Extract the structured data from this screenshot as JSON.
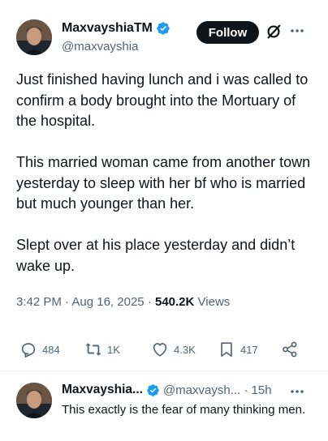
{
  "tweet": {
    "display_name": "MaxvayshiaTM",
    "handle": "@maxvayshia",
    "follow_label": "Follow",
    "body": "Just finished having lunch and i was called to confirm a body brought into the Mortuary of the hospital.\n\nThis married woman came from another town yesterday to sleep with her bf who is married but much younger than her.\n\nSlept over at his place yesterday and didn’t wake up.",
    "time": "3:42 PM",
    "sep1": "·",
    "date": "Aug 16, 2025",
    "sep2": "·",
    "views_count": "540.2K",
    "views_label": "Views",
    "stats": {
      "replies": "484",
      "reposts": "1K",
      "likes": "4.3K",
      "bookmarks": "417"
    },
    "colors": {
      "text": "#0f1419",
      "muted": "#536471",
      "verified": "#1d9bf0",
      "follow_bg": "#0f1419"
    },
    "icons": [
      "verified-badge-icon",
      "grok-icon",
      "more-icon",
      "reply-icon",
      "repost-icon",
      "like-icon",
      "bookmark-icon",
      "share-icon"
    ]
  },
  "reply": {
    "display_name": "Maxvayshia...",
    "handle_time": "@maxvaysh... · 15h",
    "text": "This exactly is the fear of many thinking men."
  }
}
